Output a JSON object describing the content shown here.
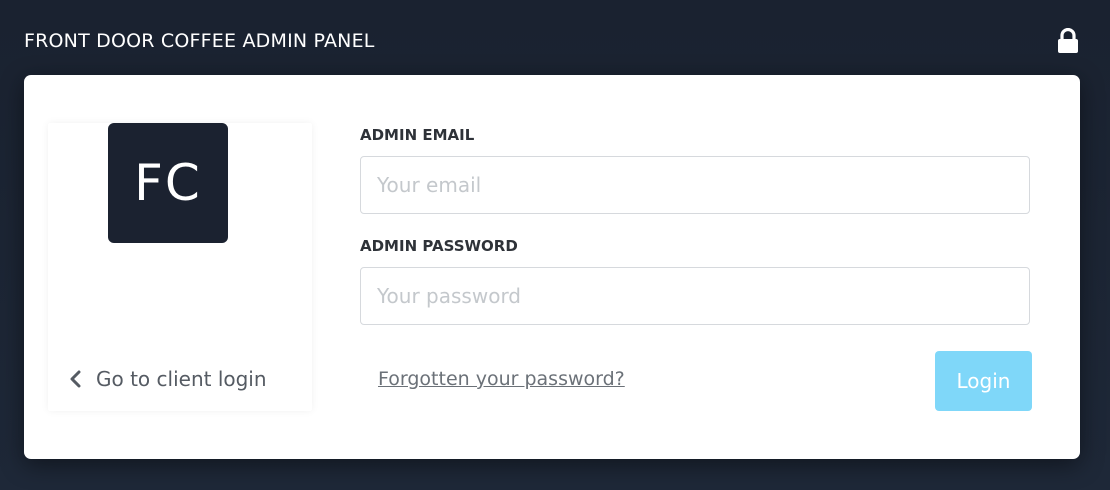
{
  "header": {
    "title": "FRONT DOOR COFFEE ADMIN PANEL",
    "lock_icon": "lock-icon"
  },
  "sidebar": {
    "logo_text": "FC",
    "client_login_label": "Go to client login",
    "chevron_icon": "chevron-left-icon"
  },
  "form": {
    "email_label": "ADMIN EMAIL",
    "email_placeholder": "Your email",
    "email_value": "",
    "password_label": "ADMIN PASSWORD",
    "password_placeholder": "Your password",
    "password_value": "",
    "forgot_label": "Forgotten your password?",
    "login_label": "Login"
  },
  "colors": {
    "background": "#1d2736",
    "card": "#ffffff",
    "logo_bg": "#1b2230",
    "login_button": "#7fd7f9"
  }
}
